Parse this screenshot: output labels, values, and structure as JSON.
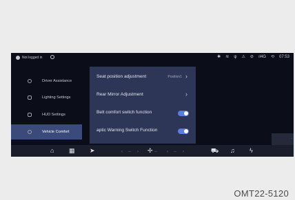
{
  "status_bar": {
    "login_text": "Not logged in",
    "icons": [
      "user-icon",
      "compass-icon",
      "bluetooth-icon",
      "wifi-icon",
      "signal-icon",
      "warning-icon",
      "mute-icon",
      "network-icon",
      "wireless-icon"
    ],
    "network": "4G",
    "time": "07:53"
  },
  "sidebar": {
    "items": [
      {
        "label": "Driver Assistance",
        "icon": "steering-icon"
      },
      {
        "label": "Lighting Settings",
        "icon": "light-icon"
      },
      {
        "label": "HUD Settings",
        "icon": "hud-icon"
      },
      {
        "label": "Vehicle Comfort",
        "icon": "comfort-icon",
        "active": true
      }
    ]
  },
  "panel": {
    "rows": [
      {
        "label": "Seat position adjustment",
        "value": "Position1",
        "control": "chevron"
      },
      {
        "label": "Rear Mirror Adjustment",
        "control": "chevron"
      },
      {
        "label": "Belt comfort switch function",
        "control": "toggle",
        "on": true
      },
      {
        "label": "aptic Warning Switch Function",
        "control": "toggle",
        "on": true
      }
    ]
  },
  "dock": {
    "left_temp": "--",
    "right_temp": "--",
    "icons": [
      "home-icon",
      "apps-icon",
      "navigation-icon",
      "fan-icon",
      "car-icon",
      "music-icon",
      "energy-icon"
    ]
  },
  "caption": "OMT22-5120"
}
